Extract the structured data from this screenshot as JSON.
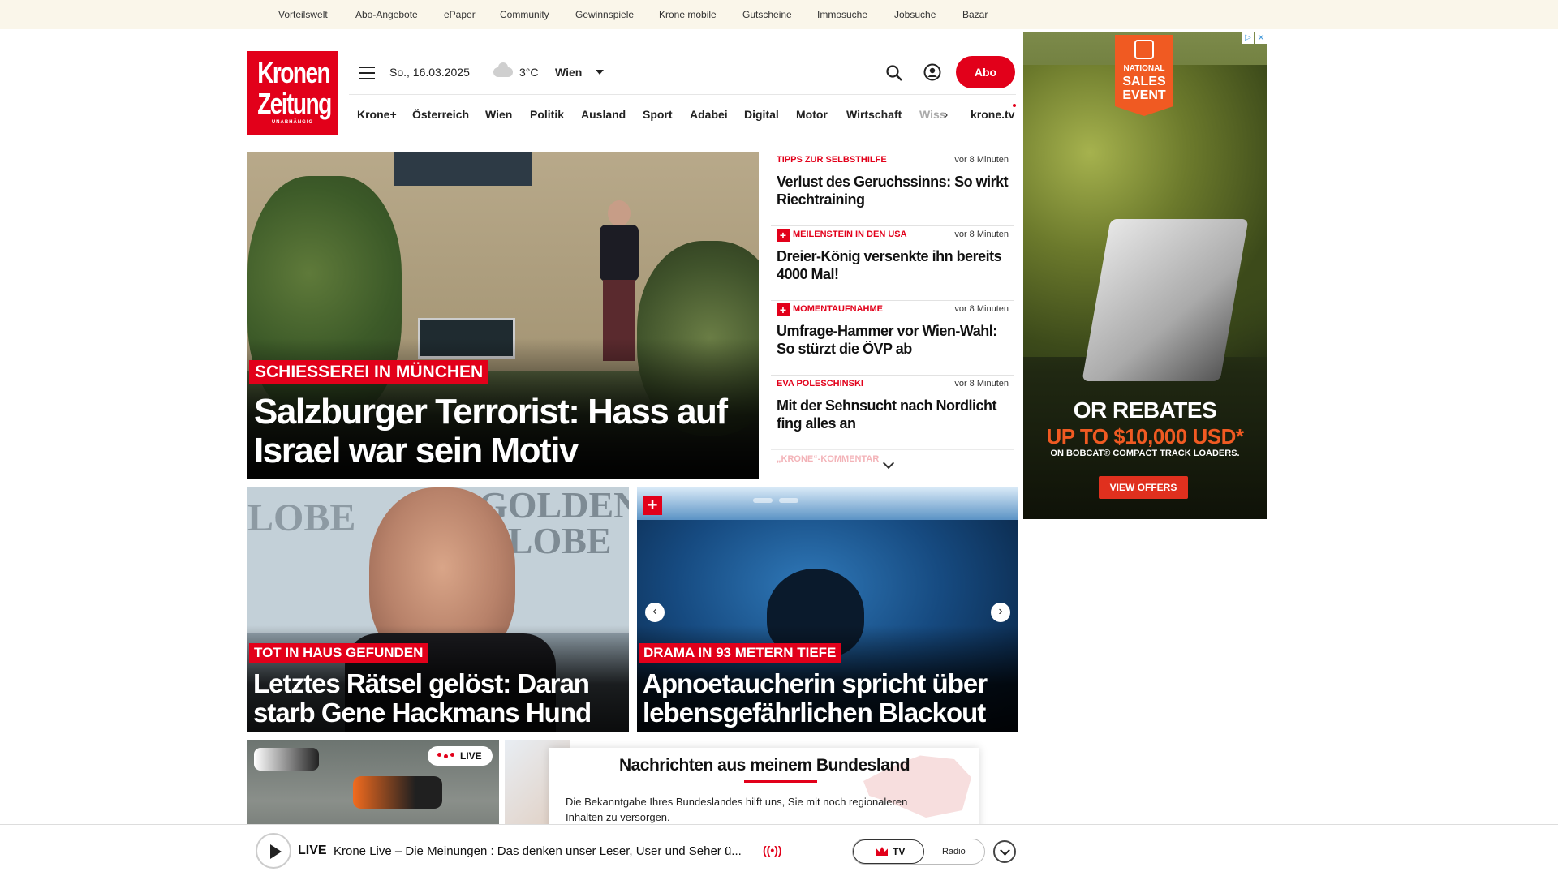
{
  "topbar": {
    "items": [
      "Vorteilswelt",
      "Abo-Angebote",
      "ePaper",
      "Community",
      "Gewinnspiele",
      "Krone mobile",
      "Gutscheine",
      "Immosuche",
      "Jobsuche",
      "Bazar"
    ]
  },
  "logo": {
    "line1": "Kronen",
    "line2": "Zeitung",
    "tagline": "UNABHÄNGIG"
  },
  "header": {
    "date": "So., 16.03.2025",
    "weather_icon": "cloud-icon",
    "temperature": "3°C",
    "city": "Wien",
    "abo_label": "Abo"
  },
  "nav": {
    "items": [
      "Krone+",
      "Österreich",
      "Wien",
      "Politik",
      "Ausland",
      "Sport",
      "Adabei",
      "Digital",
      "Motor",
      "Wirtschaft",
      "Wiss"
    ],
    "tv": "krone.tv"
  },
  "hero": {
    "kicker": "SCHIESSEREI IN MÜNCHEN",
    "title": "Salzburger Terrorist: Hass auf Israel war sein Motiv"
  },
  "teasers": [
    {
      "kicker": "TIPPS ZUR SELBSTHILFE",
      "plus": false,
      "time": "vor 8 Minuten",
      "title": "Verlust des Geruchssinns: So wirkt Riechtraining"
    },
    {
      "kicker": "MEILENSTEIN IN DEN USA",
      "plus": true,
      "time": "vor 8 Minuten",
      "title": "Dreier-König versenkte ihn bereits 4000 Mal!"
    },
    {
      "kicker": "MOMENTAUFNAHME",
      "plus": true,
      "time": "vor 8 Minuten",
      "title": "Umfrage-Hammer vor Wien-Wahl: So stürzt die ÖVP ab"
    },
    {
      "kicker": "EVA POLESCHINSKI",
      "plus": false,
      "time": "vor 8 Minuten",
      "title": "Mit der Sehnsucht nach Nordlicht fing alles an"
    }
  ],
  "teaser_more": {
    "kicker": "„KRONE“-KOMMENTAR"
  },
  "cards": [
    {
      "kicker": "TOT IN HAUS GEFUNDEN",
      "title": "Letztes Rätsel gelöst: Daran starb Gene Hackmans Hund",
      "bg_text1": "LOBE",
      "bg_text2": "GOLDEN GLOBE"
    },
    {
      "kicker": "DRAMA IN 93 METERN TIEFE",
      "title": "Apnoetaucherin spricht über lebensgefährlichen Blackout",
      "plus": "+"
    }
  ],
  "ad": {
    "ribbon_small": "NATIONAL",
    "ribbon_big": "SALES EVENT",
    "headline1": "OR REBATES",
    "headline2": "UP TO $10,000 USD*",
    "subline": "ON BOBCAT® COMPACT TRACK LOADERS.",
    "cta": "VIEW OFFERS"
  },
  "live_badge": "LIVE",
  "bundesland": {
    "title": "Nachrichten aus meinem Bundesland",
    "text": "Die Bekanntgabe Ihres Bundeslandes hilft uns, Sie mit noch regionaleren Inhalten zu versorgen."
  },
  "player": {
    "live_label": "LIVE",
    "title": "Krone Live – Die Meinungen : Das denken unser Leser, User und Seher ü...",
    "tv_label": "TV",
    "radio_label": "Radio"
  },
  "colors": {
    "brand_red": "#e2001a",
    "topbar_bg": "#faf6ea",
    "ad_orange": "#f05a22"
  }
}
